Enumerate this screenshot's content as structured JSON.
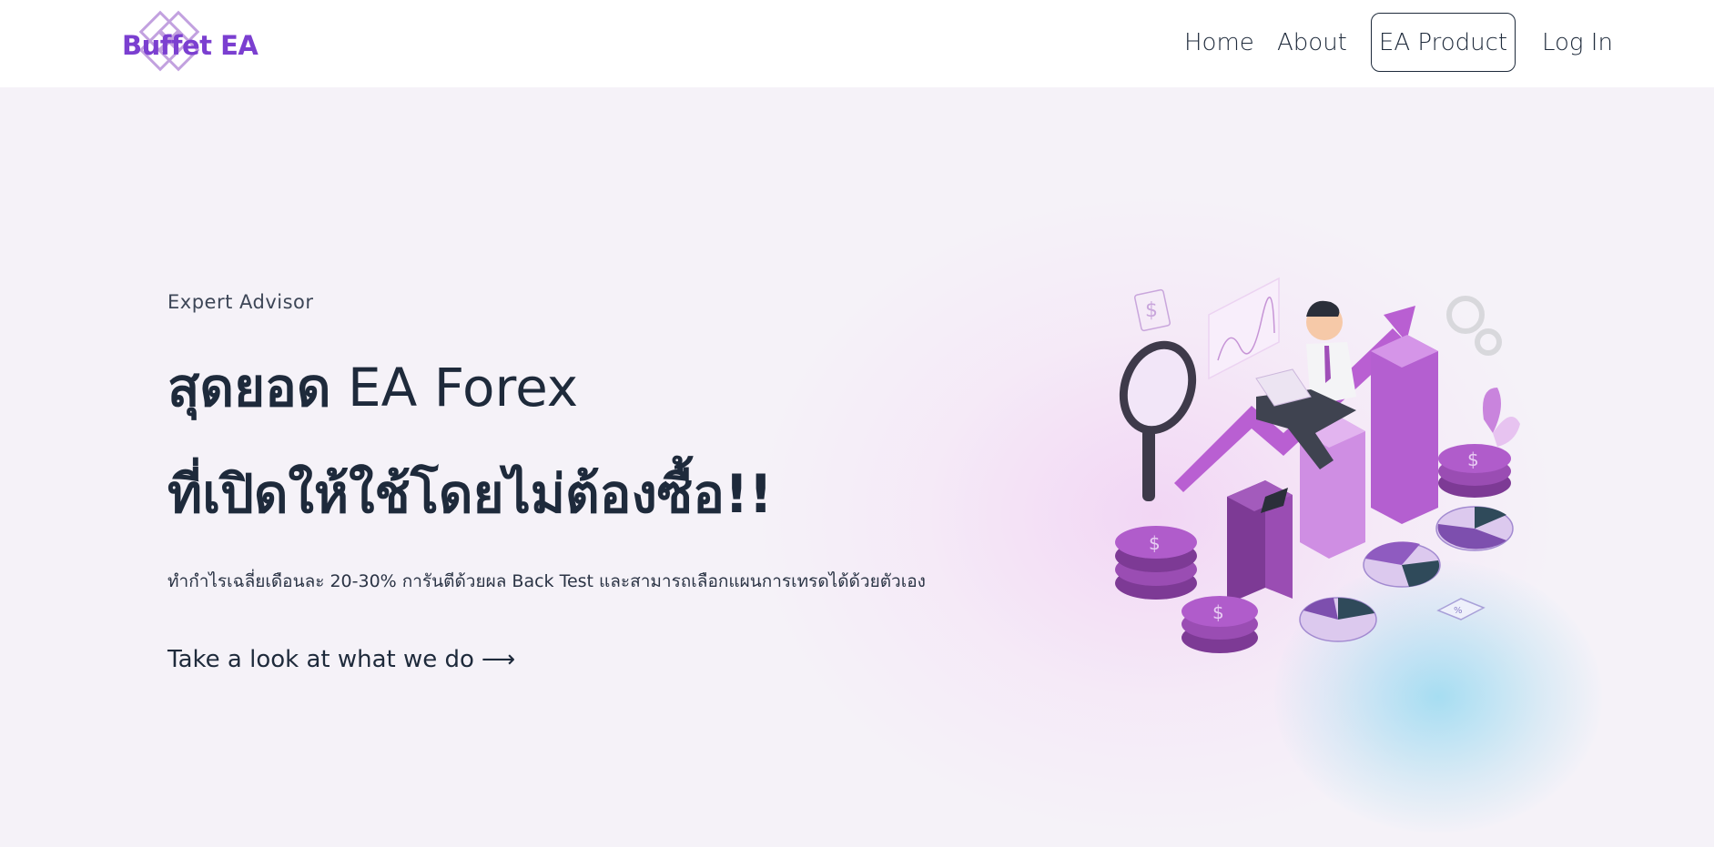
{
  "header": {
    "logo_text": "Buffet EA",
    "nav": {
      "home": "Home",
      "about": "About",
      "ea_product": "EA Product",
      "login": "Log In"
    }
  },
  "hero": {
    "eyebrow": "Expert Advisor",
    "headline_line1_thai": "สุดยอด",
    "headline_line1_en": " EA Forex",
    "headline_line2": "ที่เปิดให้ใช้โดยไม่ต้องซื้อ!!",
    "subtitle": "ทำกำไรเฉลี่ยเดือนละ 20-30% การันตีด้วยผล Back Test และสามารถเลือกแผนการเทรดได้ด้วยตัวเอง",
    "cta_label": "Take a look at what we do",
    "cta_arrow": "⟶"
  },
  "colors": {
    "brand_purple": "#7b3fd0",
    "text_dark": "#1e2a3b",
    "background": "#f5f2f8",
    "illustration_purple": "#b45fd0",
    "illustration_dark_purple": "#7d3a95",
    "illustration_teal": "#2f4a5a"
  },
  "icons": {
    "logo": "interlocking-diamond-logo-icon",
    "illustration": "finance-growth-illustration"
  }
}
